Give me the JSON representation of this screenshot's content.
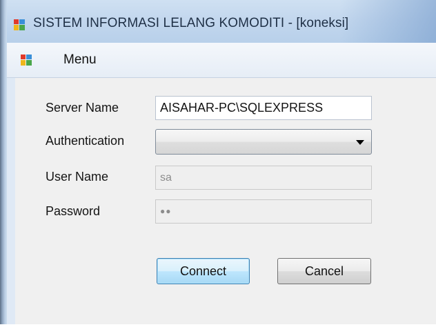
{
  "window": {
    "title": "SISTEM INFORMASI LELANG KOMODITI - [koneksi]",
    "icon": "app-window-icon"
  },
  "menu": {
    "items": [
      {
        "label": "Menu",
        "icon": "app-window-icon"
      }
    ]
  },
  "form": {
    "server_name": {
      "label": "Server Name",
      "value": "AISAHAR-PC\\SQLEXPRESS"
    },
    "authentication": {
      "label": "Authentication",
      "selected": ""
    },
    "user_name": {
      "label": "User Name",
      "value": "sa",
      "enabled": false
    },
    "password": {
      "label": "Password",
      "masked_value": "●●",
      "enabled": false
    }
  },
  "buttons": {
    "connect_label": "Connect",
    "cancel_label": "Cancel"
  },
  "colors": {
    "title_bar": "#c3d7ee",
    "client_background": "#f0f0f0",
    "default_button_border": "#3c7fb1"
  }
}
